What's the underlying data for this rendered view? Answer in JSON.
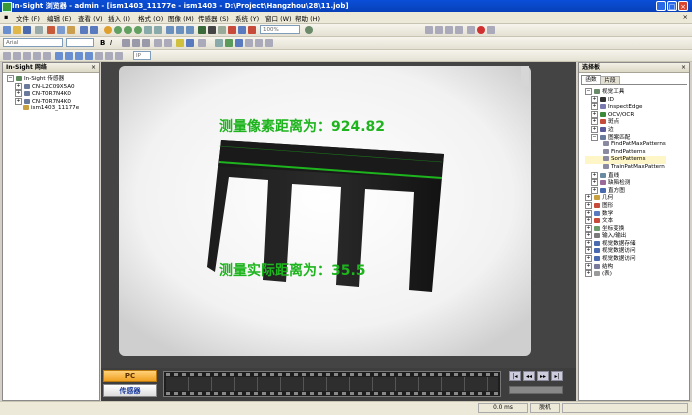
{
  "window": {
    "title": "In-Sight 浏览器 - admin - [ism1403_11177e - ism1403 - D:\\Project\\Hangzhou\\28\\11.job]"
  },
  "menu": [
    "文件 (F)",
    "编辑 (E)",
    "查看 (V)",
    "插入 (I)",
    "格式 (O)",
    "图像 (M)",
    "传感器 (S)",
    "系统 (Y)",
    "窗口 (W)",
    "帮助 (H)"
  ],
  "toolbar": {
    "font_value": "Arial",
    "zoom_value": "100%",
    "last_box": "IP"
  },
  "network_panel": {
    "title": "In-Sight 网络",
    "root": "In-Sight 传感器",
    "items": [
      "CN-L2C09X5A0",
      "CN-T0R7N4K0",
      "CN-T0R7N4K0",
      "ism1403_11177e"
    ]
  },
  "image": {
    "pixel_text": "测量像素距离为：",
    "pixel_value": "924.82",
    "real_text": "测量实际距离为：",
    "real_value": "35.5"
  },
  "bottom": {
    "pc_label": "PC",
    "sensor_label": "传感器"
  },
  "palette": {
    "title": "选择板",
    "tabs": [
      "函数",
      "片段"
    ],
    "tree": [
      "视觉工具",
      "ID",
      "InspectEdge",
      "OCV/OCR",
      "斑点",
      "边",
      "图案匹配",
      "FindPatMaxPatterns",
      "FindPatterns",
      "SortPatterns",
      "TrainPatMaxPattern",
      "直线",
      "缺陷检测",
      "直方图",
      "几何",
      "图形",
      "数学",
      "文本",
      "坐标变换",
      "输入/输出",
      "视觉数据存储",
      "视觉数据访问",
      "视觉数据访问",
      "结构",
      "(表)"
    ]
  },
  "status": {
    "time": "0.0 ms",
    "mode": "脱机"
  },
  "colors": {
    "measure_green": "#1db41d",
    "title_blue": "#0a4fd8"
  }
}
